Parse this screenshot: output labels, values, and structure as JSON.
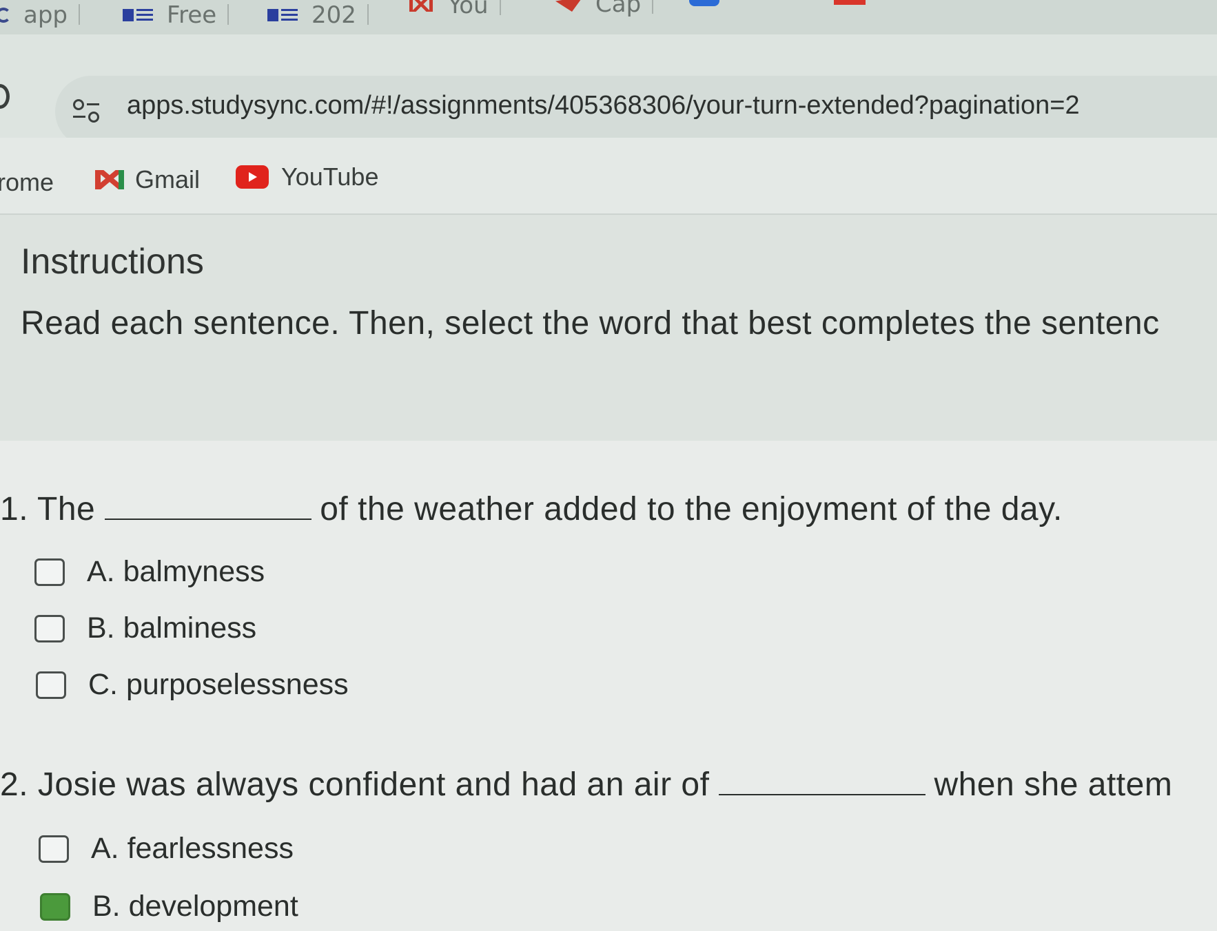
{
  "tabs": [
    {
      "label": "app",
      "icon": "google-icon"
    },
    {
      "label": "Free",
      "icon": "list-icon"
    },
    {
      "label": "202",
      "icon": "list-icon"
    },
    {
      "label": "You",
      "icon": "gmail-icon"
    },
    {
      "label": "Cap",
      "icon": "arrow-icon"
    }
  ],
  "address_bar": {
    "url": "apps.studysync.com/#!/assignments/405368306/your-turn-extended?pagination=2"
  },
  "bookmarks": [
    {
      "label": "rome"
    },
    {
      "label": "Gmail",
      "icon": "gmail-icon"
    },
    {
      "label": "YouTube",
      "icon": "youtube-icon"
    }
  ],
  "instructions": {
    "title": "Instructions",
    "body": "Read each sentence. Then, select the word that best completes the sentenc"
  },
  "questions": [
    {
      "prefix": "1. The",
      "suffix": "of the weather added to the enjoyment of the day.",
      "options": [
        {
          "label": "A. balmyness",
          "checked": false
        },
        {
          "label": "B. balminess",
          "checked": false
        },
        {
          "label": "C. purposelessness",
          "checked": false
        }
      ]
    },
    {
      "prefix": "2. Josie was always confident and had an air of",
      "suffix": "when she attem",
      "options": [
        {
          "label": "A. fearlessness",
          "checked": false
        },
        {
          "label": "B. development",
          "checked": true
        }
      ]
    }
  ],
  "colors": {
    "checked": "#4b9a3c",
    "youtube": "#e0231c"
  }
}
